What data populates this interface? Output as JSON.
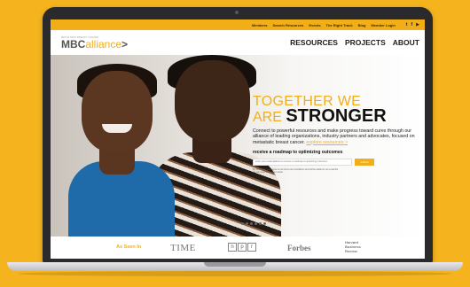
{
  "topnav": {
    "links": [
      "Members",
      "Search Resources",
      "Events",
      "The Right Track",
      "Blog",
      "Member Login"
    ],
    "social": [
      "t",
      "f",
      "▶"
    ]
  },
  "logo": {
    "tagline": "METASTATIC BREAST CANCER",
    "brand_prefix": "MBC",
    "brand_suffix": "alliance",
    "chevron": ">"
  },
  "mainnav": [
    "RESOURCES",
    "PROJECTS",
    "ABOUT"
  ],
  "hero": {
    "line1": "TOGETHER WE",
    "line2_light": "ARE ",
    "line2_bold": "STRONGER",
    "description": "Connect to powerful resources and make progress toward cures through our alliance of leading organizations, industry partners and advocates, focused on metastatic breast cancer.",
    "explore_link": "explore resources >",
    "roadmap_title": "receive a roadmap to optimizing outcomes",
    "email_placeholder": "enter your email address to receive a roadmap to optimizing outcomes",
    "submit_label": "submit",
    "disclaimer": "By submitting, you agree to our terms and conditions and will be added to our email list. we will never share your email."
  },
  "asseen": {
    "label": "As Seen In",
    "time": "TIME",
    "npr": [
      "n",
      "p",
      "r"
    ],
    "forbes": "Forbes",
    "hbr": [
      "Harvard",
      "Business",
      "Review"
    ]
  },
  "colors": {
    "accent": "#F2AE17",
    "background": "#F5B41E"
  }
}
